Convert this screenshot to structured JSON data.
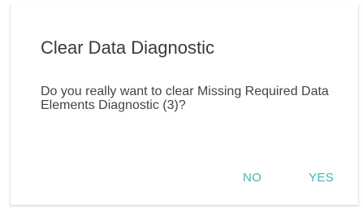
{
  "dialog": {
    "title": "Clear Data Diagnostic",
    "message": "Do you really want to clear Missing Required Data Elements Diagnostic (3)?",
    "buttons": {
      "no_label": "NO",
      "yes_label": "YES"
    }
  },
  "colors": {
    "accent": "#3fb8b0",
    "title_text": "#3a3a3a",
    "body_text": "#444444"
  }
}
